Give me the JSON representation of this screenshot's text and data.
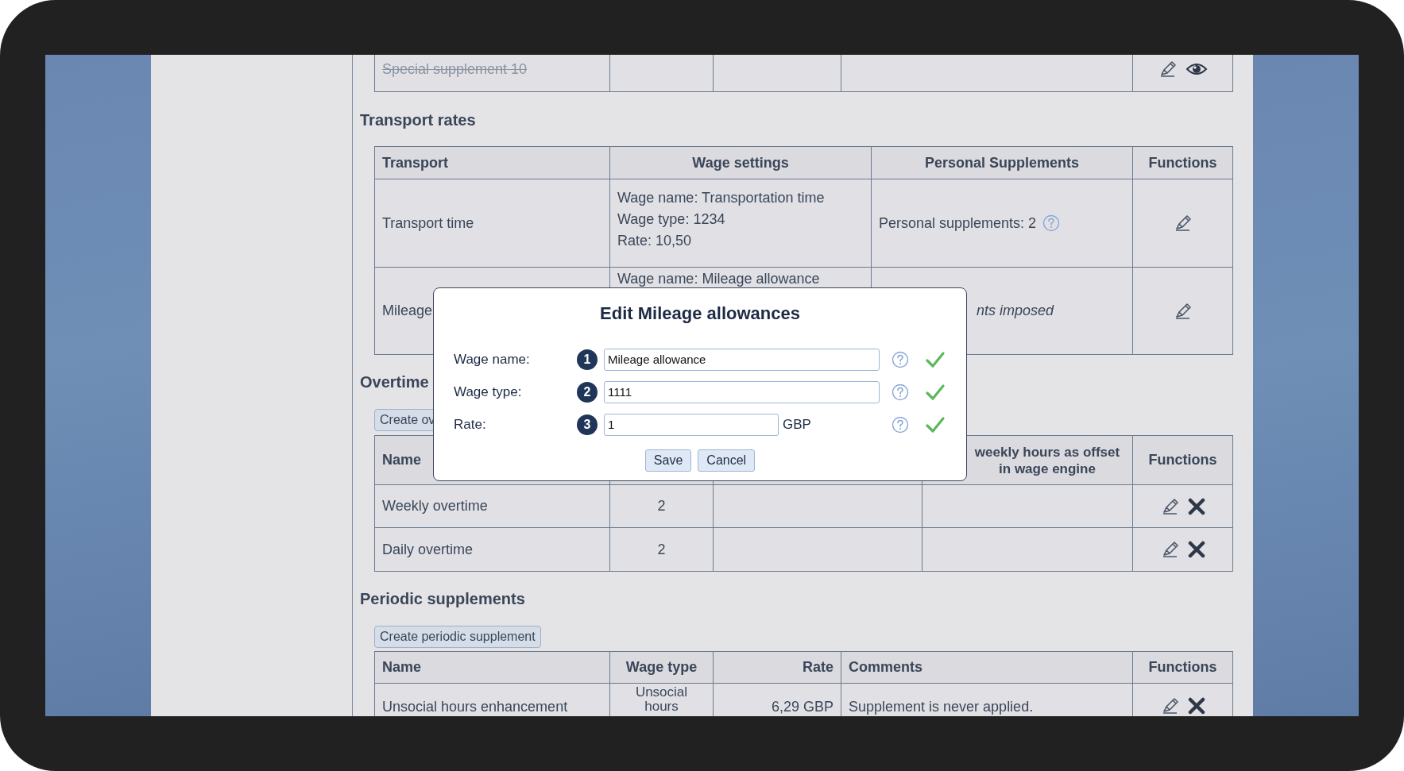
{
  "top_table": {
    "rows": [
      {
        "name": "Special supplement 10",
        "disabled": true,
        "actions": [
          {
            "kind": "edit"
          },
          {
            "kind": "view"
          }
        ]
      }
    ]
  },
  "transport": {
    "heading": "Transport rates",
    "columns": [
      "Transport",
      "Wage settings",
      "Personal Supplements",
      "Functions"
    ],
    "rows": [
      {
        "transport": "Transport time",
        "wage_settings": [
          "Wage name: Transportation time",
          "Wage type: 1234",
          "Rate: 10,50"
        ],
        "personal": "Personal supplements: 2",
        "help": true,
        "italic": false,
        "actions": [
          {
            "kind": "edit"
          }
        ]
      },
      {
        "transport": "Mileage",
        "wage_settings": [
          "Wage name: Mileage allowance"
        ],
        "personal": "nts imposed",
        "help": false,
        "italic": true,
        "actions": [
          {
            "kind": "edit"
          }
        ]
      }
    ]
  },
  "overtime": {
    "heading": "Overtime",
    "create_button": "Create ov",
    "columns": [
      {
        "label": "Name"
      },
      {},
      {},
      {
        "label": "weekly hours as offset in wage engine"
      },
      {
        "label": "Functions"
      }
    ],
    "rows": [
      {
        "name": "Weekly overtime",
        "column_2": "2",
        "actions": [
          {
            "kind": "edit"
          },
          {
            "kind": "delete"
          }
        ]
      },
      {
        "name": "Daily overtime",
        "column_2": "2",
        "actions": [
          {
            "kind": "edit"
          },
          {
            "kind": "delete"
          }
        ]
      }
    ]
  },
  "periodic": {
    "heading": "Periodic supplements",
    "create_button": "Create periodic supplement",
    "columns": [
      "Name",
      "Wage type",
      "Rate",
      "Comments",
      "Functions"
    ],
    "rows": [
      {
        "name": "Unsocial hours enhancement",
        "wage_type": "Unsocial hours",
        "rate": "6,29 GBP",
        "comments": "Supplement is never applied.",
        "actions": [
          {
            "kind": "edit"
          },
          {
            "kind": "delete"
          }
        ]
      }
    ]
  },
  "dialog": {
    "title": "Edit Mileage allowances",
    "fields": [
      {
        "number": "1",
        "label": "Wage name:",
        "value": "Mileage allowance",
        "valid": true
      },
      {
        "number": "2",
        "label": "Wage type:",
        "value": "1111",
        "valid": true
      },
      {
        "number": "3",
        "label": "Rate:",
        "value": "1",
        "unit": "GBP",
        "valid": true
      }
    ],
    "buttons": [
      "Save",
      "Cancel"
    ]
  }
}
